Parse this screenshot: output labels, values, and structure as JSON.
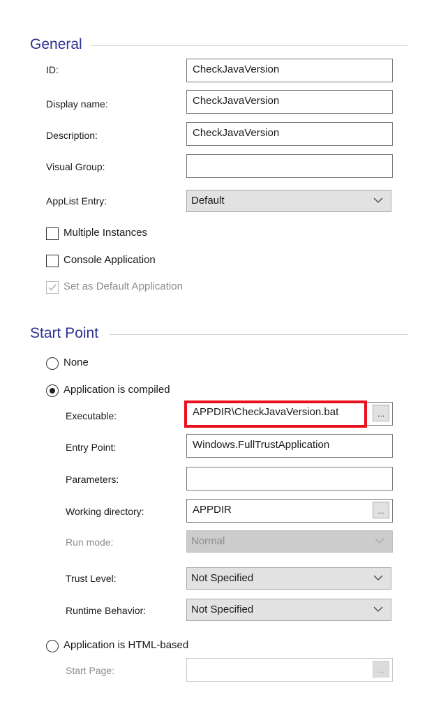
{
  "general": {
    "title": "General",
    "fields": {
      "id": {
        "label": "ID:",
        "value": "CheckJavaVersion"
      },
      "display_name": {
        "label": "Display name:",
        "value": "CheckJavaVersion"
      },
      "description": {
        "label": "Description:",
        "value": "CheckJavaVersion"
      },
      "visual_group": {
        "label": "Visual Group:",
        "value": ""
      },
      "applist_entry": {
        "label": "AppList Entry:",
        "value": "Default"
      }
    },
    "checkboxes": {
      "multiple_instances": {
        "label": "Multiple Instances",
        "checked": false
      },
      "console_application": {
        "label": "Console Application",
        "checked": false
      },
      "default_application": {
        "label": "Set as Default Application",
        "checked": true,
        "disabled": true
      }
    }
  },
  "start_point": {
    "title": "Start Point",
    "radios": {
      "none": {
        "label": "None",
        "selected": false
      },
      "compiled": {
        "label": "Application is compiled",
        "selected": true
      },
      "html": {
        "label": "Application is HTML-based",
        "selected": false
      }
    },
    "fields": {
      "executable": {
        "label": "Executable:",
        "value": "APPDIR\\CheckJavaVersion.bat",
        "highlighted": true,
        "highlight_color": "#e8121f"
      },
      "entry_point": {
        "label": "Entry Point:",
        "value": "Windows.FullTrustApplication"
      },
      "parameters": {
        "label": "Parameters:",
        "value": ""
      },
      "working_directory": {
        "label": "Working directory:",
        "value": "APPDIR"
      },
      "run_mode": {
        "label": "Run mode:",
        "value": "Normal",
        "disabled": true
      },
      "trust_level": {
        "label": "Trust Level:",
        "value": "Not Specified"
      },
      "runtime_behavior": {
        "label": "Runtime Behavior:",
        "value": "Not Specified"
      },
      "start_page": {
        "label": "Start Page:",
        "value": "",
        "disabled": true
      }
    },
    "browse_label": "..."
  },
  "colors": {
    "section_title": "#2e3192",
    "highlight": "#e8121f"
  }
}
